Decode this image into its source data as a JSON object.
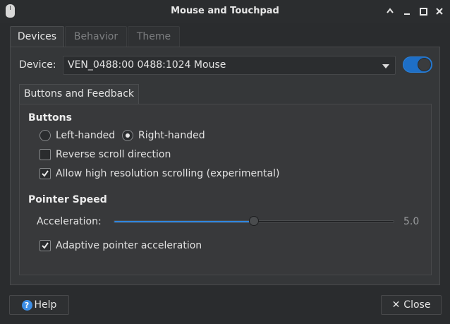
{
  "window": {
    "title": "Mouse and Touchpad"
  },
  "tabs": [
    {
      "label": "Devices",
      "active": true
    },
    {
      "label": "Behavior",
      "active": false
    },
    {
      "label": "Theme",
      "active": false
    }
  ],
  "device": {
    "label": "Device:",
    "selected": "VEN_0488:00 0488:1024 Mouse",
    "enabled": true
  },
  "inner_tab": {
    "label": "Buttons and Feedback"
  },
  "buttons_section": {
    "heading": "Buttons",
    "left_handed": "Left-handed",
    "right_handed": "Right-handed",
    "selected_hand": "right",
    "reverse_scroll": {
      "label": "Reverse scroll direction",
      "checked": false
    },
    "hi_res_scroll": {
      "label": "Allow high resolution scrolling (experimental)",
      "checked": true
    }
  },
  "pointer_section": {
    "heading": "Pointer Speed",
    "acceleration_label": "Acceleration:",
    "acceleration_value": "5.0",
    "acceleration_fraction": 0.5,
    "adaptive": {
      "label": "Adaptive pointer acceleration",
      "checked": true
    }
  },
  "footer": {
    "help_label": "Help",
    "close_label": "Close"
  },
  "colors": {
    "accent": "#2f86e0",
    "background": "#2a2c2e"
  }
}
